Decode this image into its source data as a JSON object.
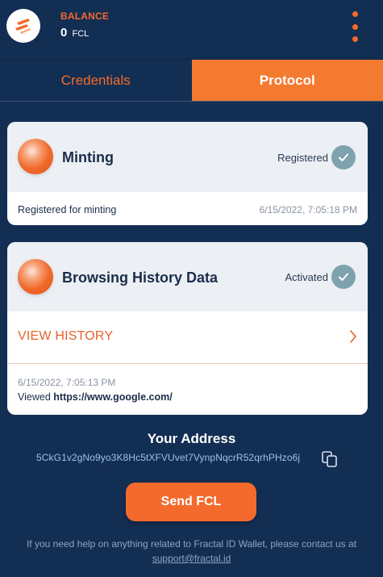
{
  "header": {
    "logo_icon": "fractal-logo-icon",
    "balance_label": "BALANCE",
    "balance_value": "0",
    "balance_unit": "FCL",
    "menu_icon": "vertical-dots-menu-icon",
    "accent_color": "#f46a2c"
  },
  "tabs": [
    {
      "label": "Credentials",
      "active": false
    },
    {
      "label": "Protocol",
      "active": true
    }
  ],
  "cards": {
    "minting": {
      "title": "Minting",
      "status": "Registered",
      "status_icon": "check-circle-icon",
      "detail": "Registered for minting",
      "timestamp": "6/15/2022, 7:05:18 PM"
    },
    "browsing": {
      "title": "Browsing History Data",
      "status": "Activated",
      "status_icon": "check-circle-icon",
      "action_label": "VIEW HISTORY",
      "history_time": "6/15/2022, 7:05:13 PM",
      "history_prefix": "Viewed",
      "history_url": "https://www.google.com/"
    }
  },
  "address": {
    "title": "Your Address",
    "value": "5CkG1v2gNo9yo3K8Hc5tXFVUvet7VynpNqcrR52qrhPHzo6j",
    "copy_icon": "copy-icon"
  },
  "send_button": "Send FCL",
  "footer": {
    "help_text": "If you need help on anything related to Fractal ID Wallet, please contact us at",
    "support_email": "support@fractal.id"
  }
}
